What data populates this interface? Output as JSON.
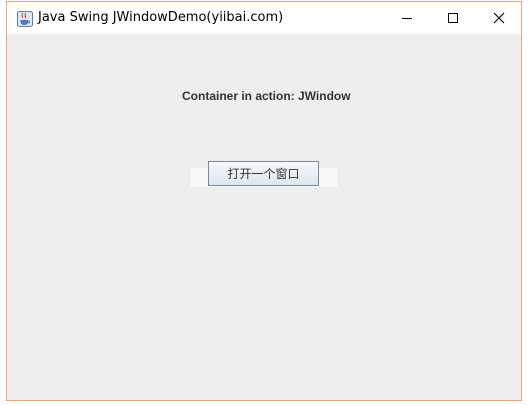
{
  "window": {
    "title": "Java Swing JWindowDemo(yiibai.com)",
    "icon": "java-coffee-icon",
    "controls": {
      "minimize_icon": "minimize-icon",
      "maximize_icon": "maximize-icon",
      "close_icon": "close-icon"
    },
    "border_color": "#e4a86f",
    "background_color": "#eeeeee"
  },
  "content": {
    "heading": "Container in action: JWindow",
    "open_button_label": "打开一个窗口"
  }
}
